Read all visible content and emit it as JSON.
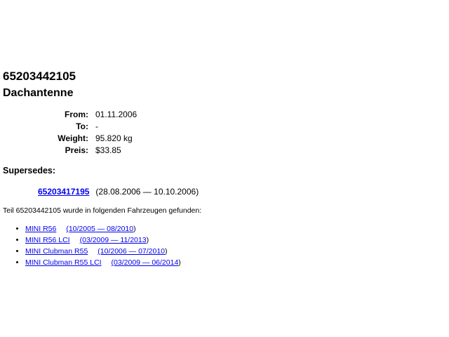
{
  "part": {
    "number": "65203442105",
    "name": "Dachantenne"
  },
  "details": [
    {
      "label": "From:",
      "value": "01.11.2006"
    },
    {
      "label": "To:",
      "value": "-"
    },
    {
      "label": "Weight:",
      "value": "95.820 kg"
    },
    {
      "label": "Preis:",
      "value": "$33.85"
    }
  ],
  "supersedes": {
    "heading": "Supersedes:",
    "part_number": "65203417195",
    "date_range": "(28.08.2006 — 10.10.2006)"
  },
  "found_text": "Teil 65203442105 wurde in folgenden Fahrzeugen gefunden:",
  "vehicles": [
    {
      "model": "MINI R56",
      "range": "(10/2005 — 08/2010"
    },
    {
      "model": "MINI R56 LCI",
      "range": "(03/2009 — 11/2013"
    },
    {
      "model": "MINI Clubman R55",
      "range": "(10/2006 — 07/2010"
    },
    {
      "model": "MINI Clubman R55 LCI",
      "range": "(03/2009 — 06/2014"
    }
  ]
}
